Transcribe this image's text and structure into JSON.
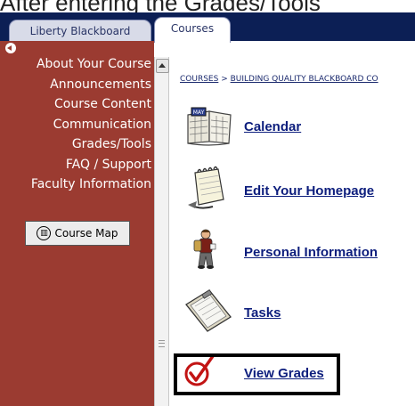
{
  "caption": "After entering the Grades/Tools",
  "tabs": [
    {
      "label": "Liberty Blackboard",
      "active": false
    },
    {
      "label": "Courses",
      "active": true
    }
  ],
  "menu": {
    "items": [
      "About Your Course",
      "Announcements",
      "Course Content",
      "Communication",
      "Grades/Tools",
      "FAQ / Support",
      "Faculty Information"
    ],
    "course_map_label": "Course Map"
  },
  "breadcrumb": {
    "root": "COURSES",
    "separator": " > ",
    "current": "BUILDING QUALITY BLACKBOARD CO"
  },
  "links": [
    {
      "label": "Calendar",
      "icon": "calendar-icon"
    },
    {
      "label": "Edit Your Homepage",
      "icon": "notepad-icon"
    },
    {
      "label": "Personal Information",
      "icon": "person-icon"
    },
    {
      "label": "Tasks",
      "icon": "clipboard-icon"
    },
    {
      "label": "View Grades",
      "icon": "checkmark-icon"
    }
  ],
  "colors": {
    "topbar": "#0c1f55",
    "left_panel": "#9b3b31",
    "link": "#0d1e7d"
  }
}
